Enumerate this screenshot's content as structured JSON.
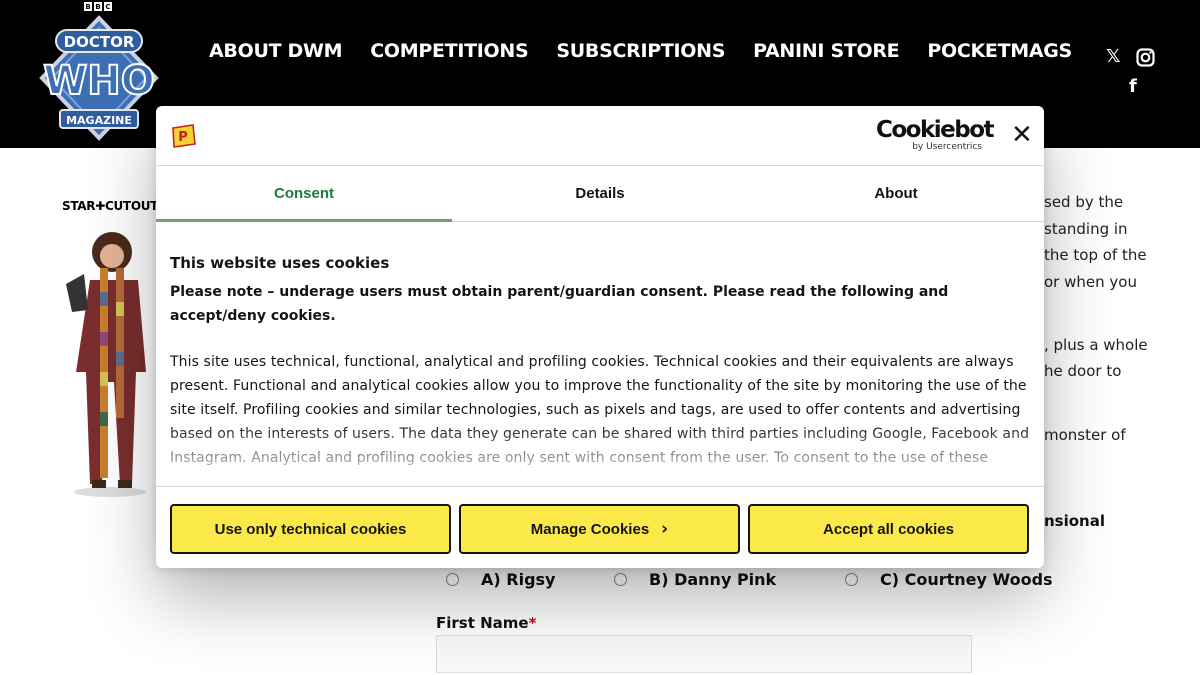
{
  "header": {
    "bbc": [
      "B",
      "B",
      "C"
    ],
    "logo_top": "DOCTOR",
    "logo_main": "WHO",
    "logo_bottom": "MAGAZINE",
    "nav": [
      "ABOUT DWM",
      "COMPETITIONS",
      "SUBSCRIPTIONS",
      "PANINI STORE",
      "POCKETMAGS"
    ],
    "social": {
      "x": "𝕏",
      "instagram": "instagram",
      "facebook": "f"
    }
  },
  "background": {
    "side_brand": "STAR✚CUTOUTS",
    "right_text": [
      "sed by the",
      "standing in",
      "the top of the",
      "or when you",
      ", plus a whole",
      "he door to",
      "monster of"
    ],
    "right_bold": "nsional",
    "quiz_options": [
      "A) Rigsy",
      "B) Danny Pink",
      "C) Courtney Woods"
    ],
    "first_name_label": "First Name",
    "required_mark": "*"
  },
  "dialog": {
    "badge_letter": "P",
    "cookiebot": {
      "name": "Cookiebot",
      "by": "by Usercentrics"
    },
    "close": "✕",
    "tabs": [
      "Consent",
      "Details",
      "About"
    ],
    "title": "This website uses cookies",
    "note": "Please note – underage users must obtain parent/guardian consent. Please read the following and accept/deny cookies.",
    "body": "This site uses technical, functional, analytical and profiling cookies. Technical cookies and their equivalents are always present.  Functional and analytical cookies allow you to improve the functionality of the site by monitoring the use of the site itself.  Profiling cookies and similar technologies, such as pixels and tags, are used to offer contents and advertising based on the interests of users.  The data they generate can be shared with third parties including Google, Facebook and Instagram. Analytical and profiling cookies are only sent with consent from the user.  To consent to the use of these",
    "buttons": {
      "technical": "Use only technical cookies",
      "manage": "Manage Cookies",
      "manage_chevron": "›",
      "accept": "Accept all cookies"
    }
  },
  "colors": {
    "header_bg": "#000000",
    "accept_yellow": "#fbe94a",
    "active_tab": "#1a7f37",
    "logo_blue": "#3d6fb5"
  }
}
